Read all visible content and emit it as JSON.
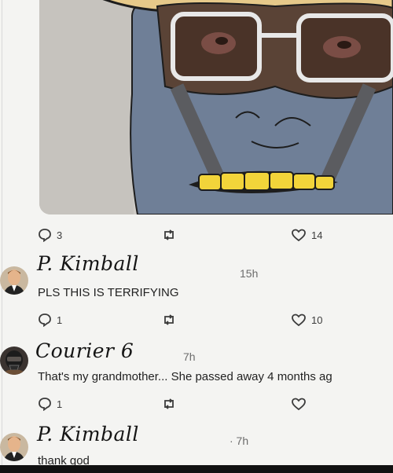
{
  "post": {
    "image_alt": "cartoon face with glasses and gold teeth",
    "actions": {
      "comments": "3",
      "retweets": "",
      "likes": "14"
    }
  },
  "replies": [
    {
      "author": "P. Kimball",
      "time": "15h",
      "text": "PLS THIS IS TERRIFYING",
      "actions": {
        "comments": "1",
        "likes": "10"
      }
    },
    {
      "author": "Courier 6",
      "time": "7h",
      "text": "That's my grandmother... She passed away 4 months ag",
      "actions": {
        "comments": "1",
        "likes": ""
      }
    },
    {
      "author": "P. Kimball",
      "time": "· 7h",
      "text": "thank god"
    }
  ],
  "colors": {
    "background": "#f4f4f2",
    "icon": "#3c3c3c",
    "face": "#6f7f97",
    "hat": "#e6c98a",
    "teeth": "#f2d43a"
  }
}
